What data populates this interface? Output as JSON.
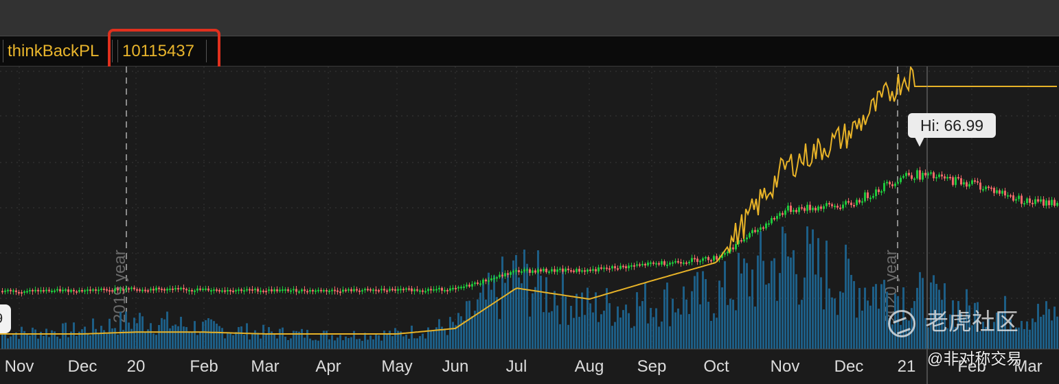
{
  "study_bar": {
    "study_name": "thinkBackPL",
    "study_value": "10115437"
  },
  "tooltip": {
    "label": "Hi: 66.99"
  },
  "price_tag": {
    "text": "9"
  },
  "watermark": {
    "text": "老虎社区"
  },
  "credit": {
    "text": "@非对称交易"
  },
  "colors": {
    "background": "#1b1b1b",
    "up_candle": "#1ec83c",
    "down_candle": "#f06a6a",
    "volume": "#1d5e86",
    "pl_line": "#e8b328",
    "highlight": "#e0301e"
  },
  "chart_data": {
    "type": "line",
    "x_tick_labels": [
      "Nov",
      "Dec",
      "20",
      "Feb",
      "Mar",
      "Apr",
      "May",
      "Jun",
      "Jul",
      "Aug",
      "Sep",
      "Oct",
      "Nov",
      "Dec",
      "21",
      "Feb",
      "Mar"
    ],
    "period_markers": [
      {
        "label": "2019 year",
        "after": "Dec"
      },
      {
        "label": "2020 year",
        "after": "Dec"
      }
    ],
    "annotation": "Hi: 66.99",
    "grid": true,
    "series": [
      {
        "kind": "candlestick",
        "x": [
          "Nov",
          "Dec",
          "20",
          "Feb",
          "Mar",
          "Apr",
          "May",
          "Jun",
          "Jul",
          "Aug",
          "Sep",
          "Oct",
          "Nov",
          "Dec",
          "21",
          "Feb",
          "Mar"
        ],
        "values": [
          10.2,
          10.5,
          11.0,
          10.8,
          10.5,
          10.4,
          10.6,
          11.0,
          18.5,
          18.8,
          21.5,
          24.0,
          44.0,
          46.0,
          59.0,
          55.0,
          47.0
        ]
      },
      {
        "kind": "line",
        "x": [
          "Nov",
          "Dec",
          "20",
          "Feb",
          "Mar",
          "Apr",
          "May",
          "Jun",
          "Jul",
          "Aug",
          "Sep",
          "Oct",
          "Nov",
          "Dec",
          "21",
          "Feb",
          "Mar"
        ],
        "values": [
          1.5,
          1.5,
          2.0,
          2.0,
          1.5,
          1.5,
          1.5,
          3.0,
          14.0,
          11.0,
          16.0,
          21.0,
          47.0,
          56.0,
          72.0,
          69.0,
          69.0
        ]
      },
      {
        "kind": "volume",
        "x": [
          "Nov",
          "Dec",
          "20",
          "Feb",
          "Mar",
          "Apr",
          "May",
          "Jun",
          "Jul",
          "Aug",
          "Sep",
          "Oct",
          "Nov",
          "Dec",
          "21",
          "Feb",
          "Mar"
        ],
        "values": [
          10,
          12,
          20,
          14,
          10,
          8,
          9,
          16,
          55,
          30,
          34,
          40,
          70,
          50,
          40,
          28,
          24
        ]
      }
    ]
  }
}
